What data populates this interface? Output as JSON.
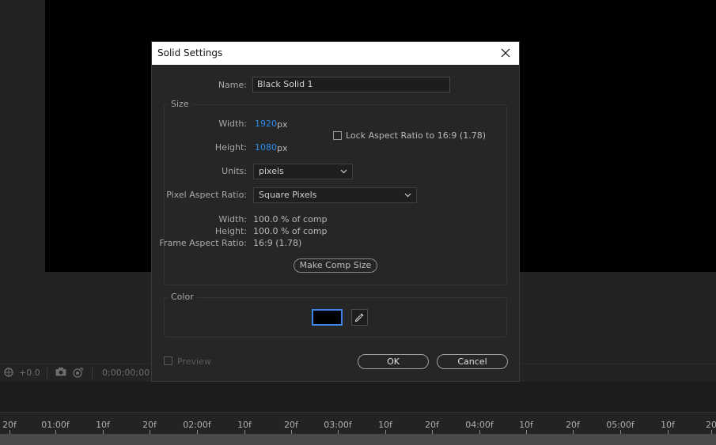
{
  "viewer_bar": {
    "exposure": "+0.0",
    "timecode": "0;00;00;00"
  },
  "timeline_ruler": {
    "ticks": [
      "20f",
      "01:00f",
      "10f",
      "20f",
      "02:00f",
      "10f",
      "20f",
      "03:00f",
      "10f",
      "20f",
      "04:00f",
      "10f",
      "20f",
      "05:00f",
      "10f",
      "20"
    ]
  },
  "dialog": {
    "title": "Solid Settings",
    "name_label": "Name:",
    "name_value": "Black Solid 1",
    "size_group": "Size",
    "width_label": "Width:",
    "width_value": "1920",
    "height_label": "Height:",
    "height_value": "1080",
    "px_unit": "px",
    "lock_aspect_label": "Lock Aspect Ratio to 16:9 (1.78)",
    "units_label": "Units:",
    "units_value": "pixels",
    "par_label": "Pixel Aspect Ratio:",
    "par_value": "Square Pixels",
    "info_width_label": "Width:",
    "info_width_value": "100.0 % of comp",
    "info_height_label": "Height:",
    "info_height_value": "100.0 % of comp",
    "far_label": "Frame Aspect Ratio:",
    "far_value": "16:9 (1.78)",
    "make_comp_size": "Make Comp Size",
    "color_group": "Color",
    "color_value": "#000000",
    "preview_label": "Preview",
    "ok_label": "OK",
    "cancel_label": "Cancel"
  },
  "colors": {
    "accent": "#2d8ceb",
    "swatch_border": "#3b86e6"
  }
}
